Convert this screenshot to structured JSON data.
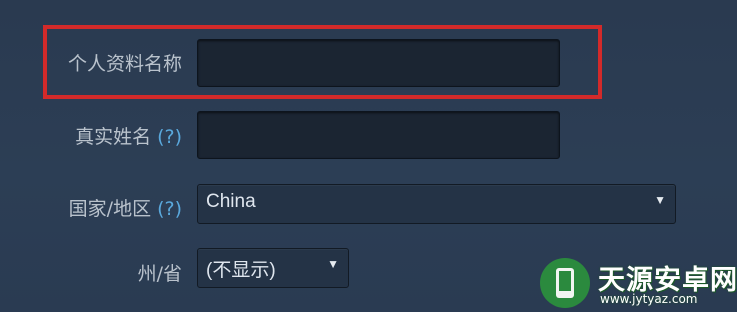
{
  "form": {
    "profile_name": {
      "label": "个人资料名称",
      "value": ""
    },
    "real_name": {
      "label": "真实姓名",
      "help": "(?)",
      "value": ""
    },
    "country": {
      "label": "国家/地区",
      "help": "(?)",
      "selected": "China"
    },
    "state": {
      "label": "州/省",
      "selected": "(不显示)"
    }
  },
  "icons": {
    "dropdown": "chevron-down-icon"
  },
  "colors": {
    "highlight": "#d32a2a",
    "help_link": "#5aa8dc"
  },
  "watermark": {
    "title": "天源安卓网",
    "url": "www.jytyaz.com"
  }
}
